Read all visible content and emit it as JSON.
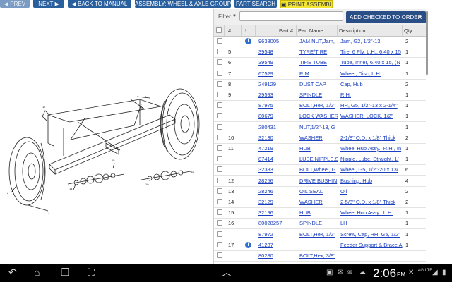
{
  "toolbar": {
    "prev_label": "PREV",
    "next_label": "NEXT",
    "back_label": "BACK TO MANUAL",
    "assembly_label": "ASSEMBLY: WHEEL & AXLE GROUP",
    "search_label": "PART SEARCH",
    "print_label": "PRINT ASSEMBLY"
  },
  "filter": {
    "label": "Filter",
    "placeholder": "",
    "add_checked_label": "ADD CHECKED TO ORDER"
  },
  "table": {
    "headers": {
      "num": "#",
      "flag": "!",
      "part": "Part #",
      "name": "Part Name",
      "desc": "Description",
      "qty": "Qty"
    },
    "rows": [
      {
        "num": "",
        "info": true,
        "part": "9638005",
        "name": "JAM NUT,Jam,",
        "desc": "Jam, G2, 1/2\"-13",
        "qty": "2"
      },
      {
        "num": "5",
        "info": false,
        "part": "39548",
        "name": "TYRE/TIRE",
        "desc": "Tire, 6 Ply, L.H., 6.40 x 15",
        "qty": "1"
      },
      {
        "num": "6",
        "info": false,
        "part": "39549",
        "name": "TIRE TUBE",
        "desc": "Tube, Inner, 6.40 x 15, (N",
        "qty": "1"
      },
      {
        "num": "7",
        "info": false,
        "part": "67529",
        "name": "RIM",
        "desc": "Wheel, Disc, L.H.",
        "qty": "1"
      },
      {
        "num": "8",
        "info": false,
        "part": "249129",
        "name": "DUST CAP",
        "desc": "Cap, Hub",
        "qty": "2"
      },
      {
        "num": "9",
        "info": false,
        "part": "29593",
        "name": "SPINDLE",
        "desc": "R.H.",
        "qty": "1"
      },
      {
        "num": "",
        "info": false,
        "part": "87975",
        "name": "BOLT,Hex, 1/2\"",
        "desc": "HH, G5, 1/2\"-13 x 2-1/4\"",
        "qty": "1"
      },
      {
        "num": "",
        "info": false,
        "part": "80679",
        "name": "LOCK WASHER",
        "desc": "WASHER, LOCK, 1/2\"",
        "qty": "1"
      },
      {
        "num": "",
        "info": false,
        "part": "280431",
        "name": "NUT,1/2\"-13, G",
        "desc": "",
        "qty": "1"
      },
      {
        "num": "10",
        "info": false,
        "part": "32130",
        "name": "WASHER",
        "desc": "2-1/8\" O.D. x 1/8\" Thick",
        "qty": "2"
      },
      {
        "num": "11",
        "info": false,
        "part": "47219",
        "name": "HUB",
        "desc": "Wheel Hub Assy., R.H., In",
        "qty": "1"
      },
      {
        "num": "",
        "info": false,
        "part": "87414",
        "name": "LUBE NIPPLE,S",
        "desc": "Nipple, Lube, Straight, 1/",
        "qty": "1"
      },
      {
        "num": "",
        "info": false,
        "part": "32383",
        "name": "BOLT,Wheel, G",
        "desc": "Wheel, G5, 1/2\"-20 x 13/",
        "qty": "6"
      },
      {
        "num": "12",
        "info": false,
        "part": "28256",
        "name": "DRIVE BUSHIN",
        "desc": "Bushing, Hub",
        "qty": "4"
      },
      {
        "num": "13",
        "info": false,
        "part": "28246",
        "name": "OIL SEAL",
        "desc": "Oil",
        "qty": "2"
      },
      {
        "num": "14",
        "info": false,
        "part": "32129",
        "name": "WASHER",
        "desc": "2-5/8\" O.D. x 1/8\" Thick",
        "qty": "2"
      },
      {
        "num": "15",
        "info": false,
        "part": "32196",
        "name": "HUB",
        "desc": "Wheel Hub Assy., L.H.",
        "qty": "1"
      },
      {
        "num": "16",
        "info": false,
        "part": "80028257",
        "name": "SPINDLE",
        "desc": "LH",
        "qty": "1"
      },
      {
        "num": "",
        "info": false,
        "part": "87972",
        "name": "BOLT,Hex, 1/2\"",
        "desc": "Screw, Cap, HH, G5, 1/2\"",
        "qty": "1"
      },
      {
        "num": "17",
        "info": true,
        "part": "41287",
        "name": "",
        "desc": "Feeder Support & Brace A",
        "qty": "1"
      },
      {
        "num": "",
        "info": false,
        "part": "80280",
        "name": "BOLT,Hex, 3/8\"",
        "desc": "",
        "qty": ""
      }
    ]
  },
  "statusbar": {
    "time": "2:06",
    "ampm": "PM",
    "battery_pct": "99",
    "signal_label": "4G LTE"
  },
  "colors": {
    "toolbar_button": "#2a5f9e",
    "print_button": "#f3e534",
    "link": "#1a3fbf",
    "info_icon": "#2d6fcf",
    "add_button": "#2a4e86"
  }
}
